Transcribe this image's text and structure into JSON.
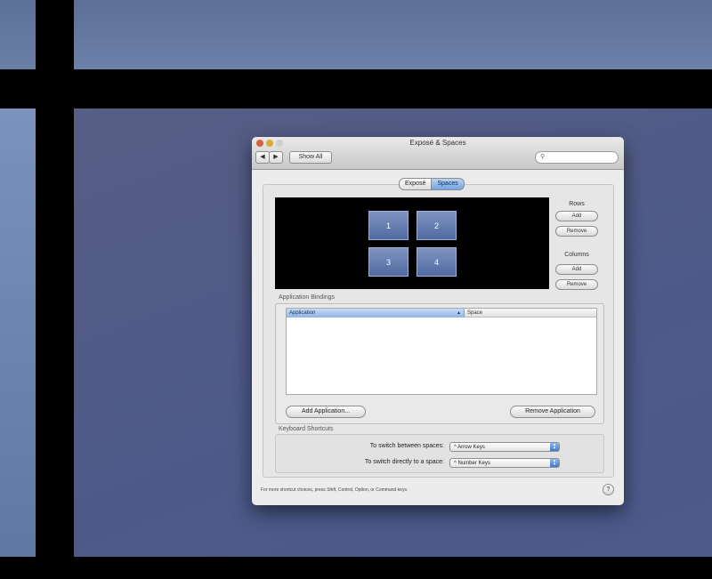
{
  "window": {
    "title": "Exposé & Spaces"
  },
  "toolbar": {
    "back": "◀",
    "forward": "▶",
    "show_all": "Show All",
    "search_placeholder": ""
  },
  "tabs": [
    {
      "label": "Exposé"
    },
    {
      "label": "Spaces",
      "selected": true
    }
  ],
  "spaces": {
    "tiles": [
      "1",
      "2",
      "3",
      "4"
    ]
  },
  "rows": {
    "label": "Rows",
    "add": "Add",
    "remove": "Remove"
  },
  "columns": {
    "label": "Columns",
    "add": "Add",
    "remove": "Remove"
  },
  "bindings": {
    "section_label": "Application Bindings",
    "columns": [
      "Application",
      "Space"
    ],
    "rows": [],
    "add_button": "Add Application...",
    "remove_button": "Remove Application"
  },
  "shortcuts": {
    "section_label": "Keyboard Shortcuts",
    "switch_between_label": "To switch between spaces:",
    "switch_between_value": "^ Arrow Keys",
    "switch_directly_label": "To switch directly to a space:",
    "switch_directly_value": "^ Number Keys"
  },
  "footer": {
    "note": "For more shortcut choices, press Shift, Control, Option, or Command keys.",
    "help": "?"
  },
  "colors": {
    "desktop": "#4d5a89",
    "selected_tab": "#73a4e2",
    "window_bg": "#ececec"
  }
}
